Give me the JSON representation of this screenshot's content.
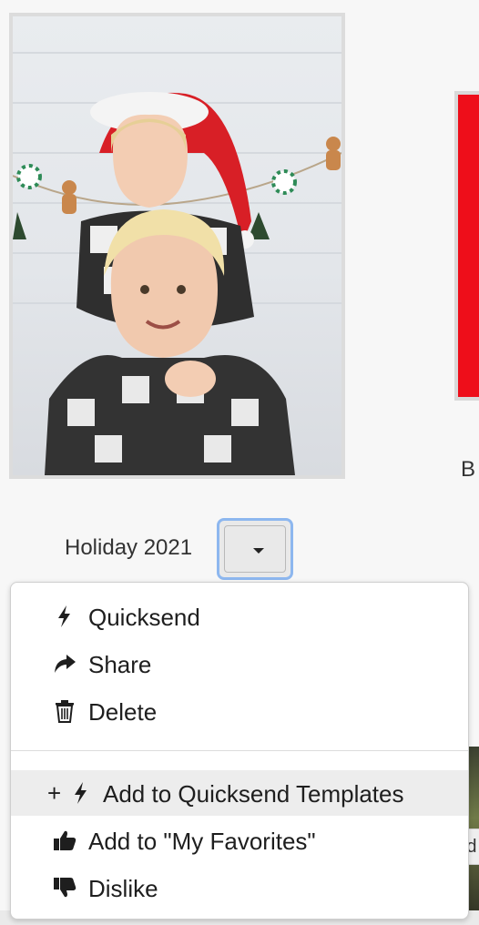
{
  "photo": {
    "alt": "Two children in plaid shirts, one in a Santa hat"
  },
  "caption": {
    "title": "Holiday 2021"
  },
  "right_side": {
    "partial_text": "B",
    "tooltip_partial": "Ad"
  },
  "menu": {
    "items": [
      {
        "label": "Quicksend",
        "icon": "lightning-icon"
      },
      {
        "label": "Share",
        "icon": "share-arrow-icon"
      },
      {
        "label": "Delete",
        "icon": "trash-icon"
      },
      {
        "label": "Add to Quicksend Templates",
        "icon": "plus-lightning-icon",
        "prefix": "+"
      },
      {
        "label": "Add to \"My Favorites\"",
        "icon": "thumbs-up-icon"
      },
      {
        "label": "Dislike",
        "icon": "thumbs-down-icon"
      }
    ]
  },
  "colors": {
    "focus_ring": "#8db7ef",
    "red_card": "#ee0e1a",
    "hover_bg": "#ededed"
  }
}
